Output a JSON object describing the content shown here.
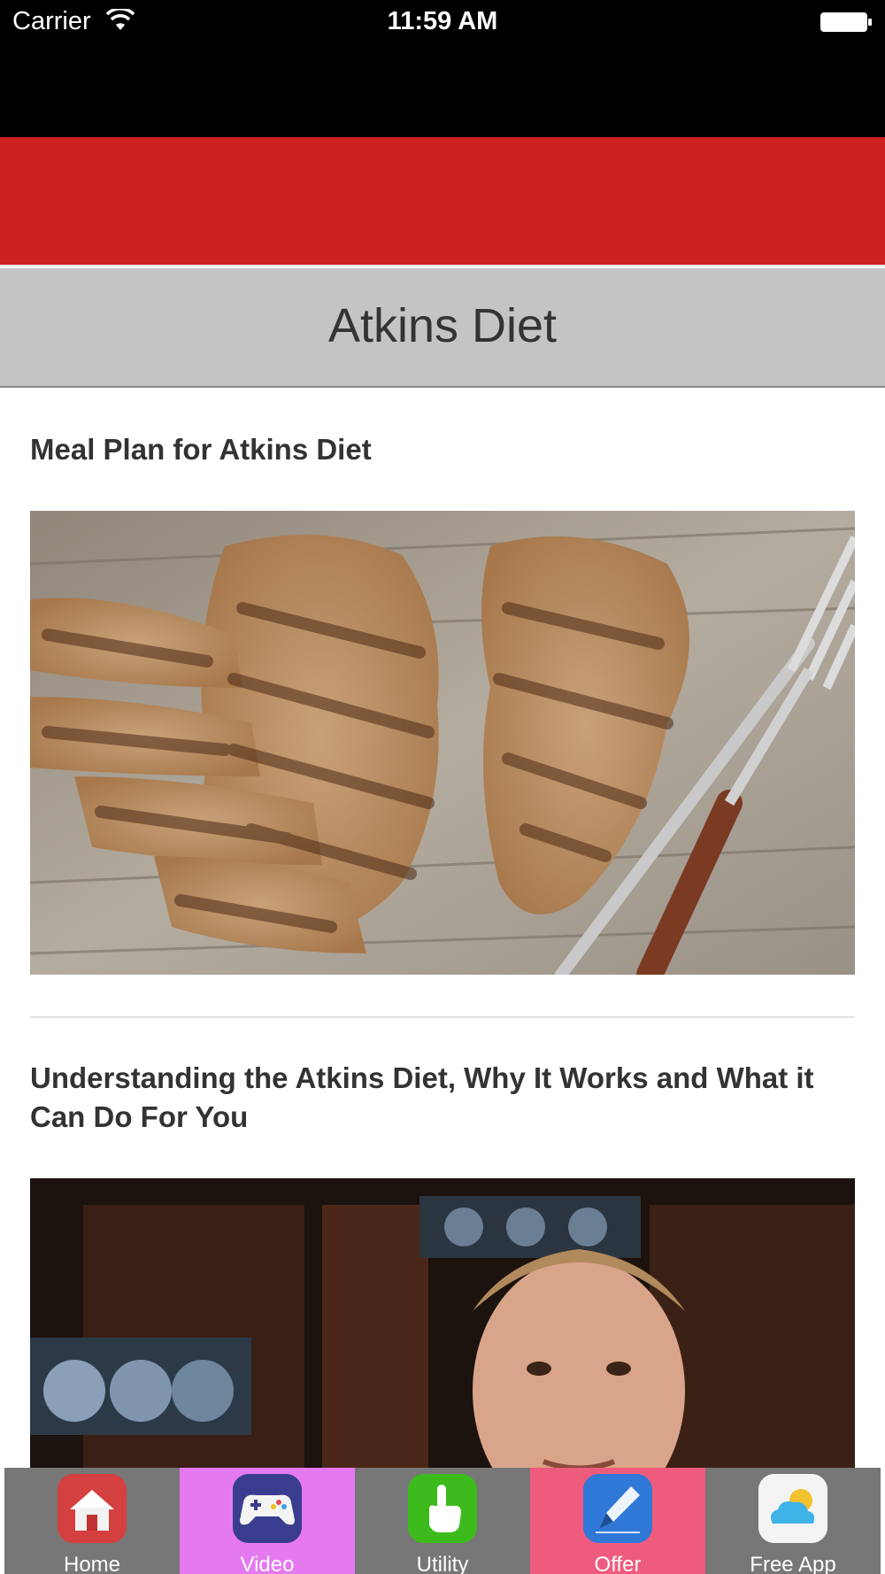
{
  "status_bar": {
    "carrier": "Carrier",
    "time": "11:59 AM"
  },
  "header": {
    "title": "Atkins Diet"
  },
  "articles": [
    {
      "title": "Meal Plan for Atkins Diet",
      "image": "grilled-chicken-photo"
    },
    {
      "title": "Understanding the Atkins Diet, Why It Works and What it Can Do For You",
      "image": "video-thumbnail-man"
    }
  ],
  "tab_bar": {
    "tabs": [
      {
        "label": "Home",
        "icon": "home-icon",
        "background": "#777777",
        "icon_color": "#d44040"
      },
      {
        "label": "Video",
        "icon": "gamepad-icon",
        "background": "#e579f0",
        "icon_color": "#3a3d8f"
      },
      {
        "label": "Utility",
        "icon": "hand-pointer-icon",
        "background": "#777777",
        "icon_color": "#3dbb1c"
      },
      {
        "label": "Offer",
        "icon": "pen-icon",
        "background": "#ee5b7d",
        "icon_color": "#2f78d8"
      },
      {
        "label": "Free App",
        "icon": "cloud-sun-icon",
        "background": "#777777",
        "icon_color": "#f4f4f4"
      }
    ]
  },
  "colors": {
    "banner_red": "#cd2020",
    "title_bar_gray": "#c4c4c4"
  }
}
